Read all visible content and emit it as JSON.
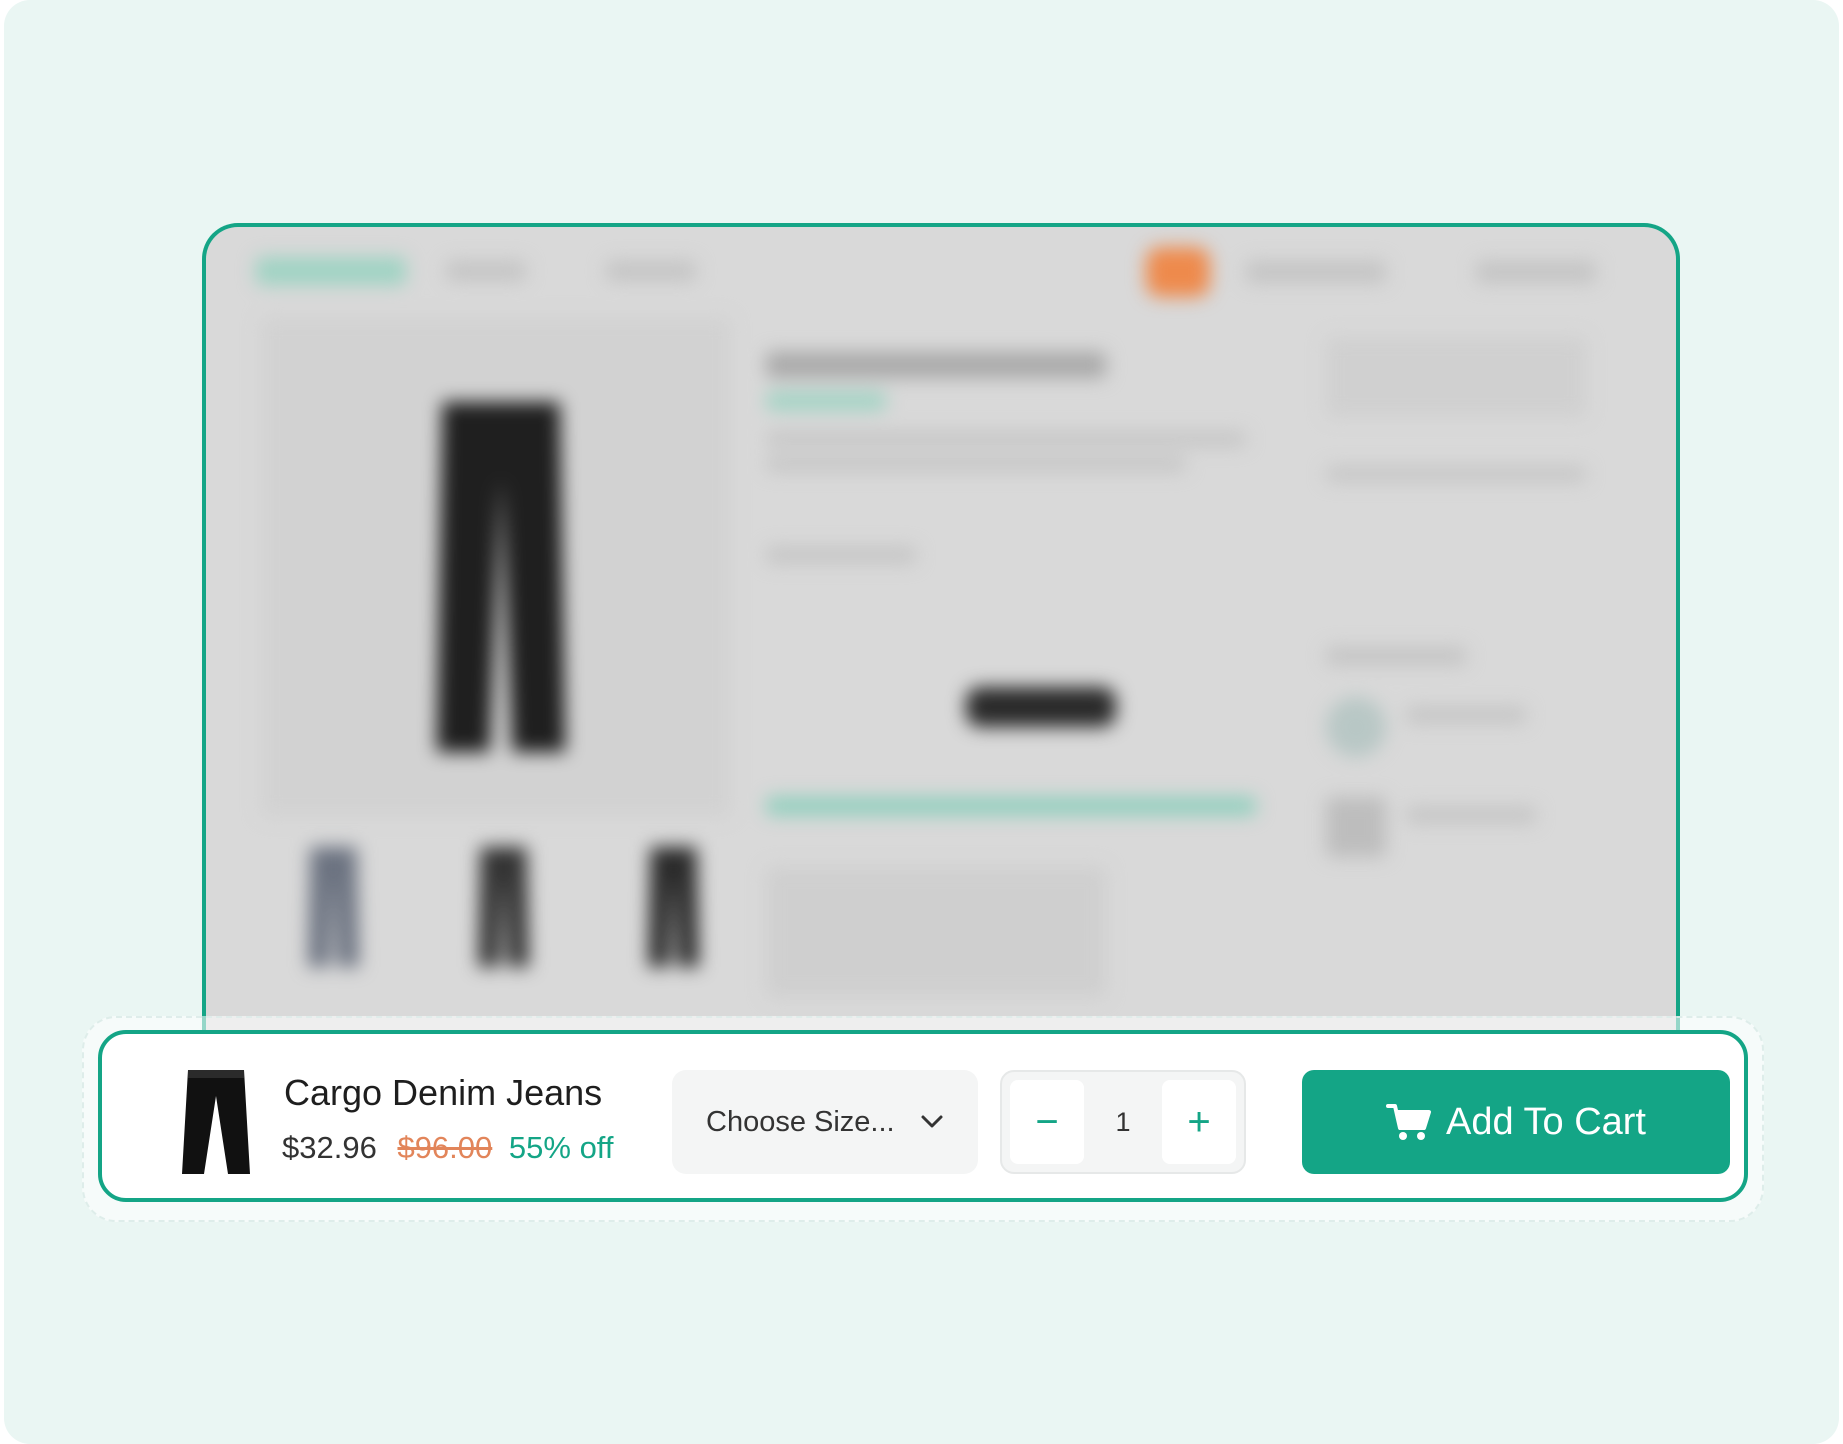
{
  "sticky_bar": {
    "product_title": "Cargo Denim Jeans",
    "price_current": "$32.96",
    "price_original": "$96.00",
    "discount": "55% off",
    "size_select": {
      "placeholder": "Choose Size..."
    },
    "quantity": {
      "value": "1",
      "decrement_symbol": "−",
      "increment_symbol": "+"
    },
    "add_to_cart_label": "Add To Cart"
  },
  "colors": {
    "accent": "#14a586",
    "old_price": "#e2855a",
    "background": "#eaf6f3"
  },
  "icons": {
    "dropdown": "chevron-down-icon",
    "cart": "cart-icon",
    "product": "jeans-thumbnail"
  }
}
